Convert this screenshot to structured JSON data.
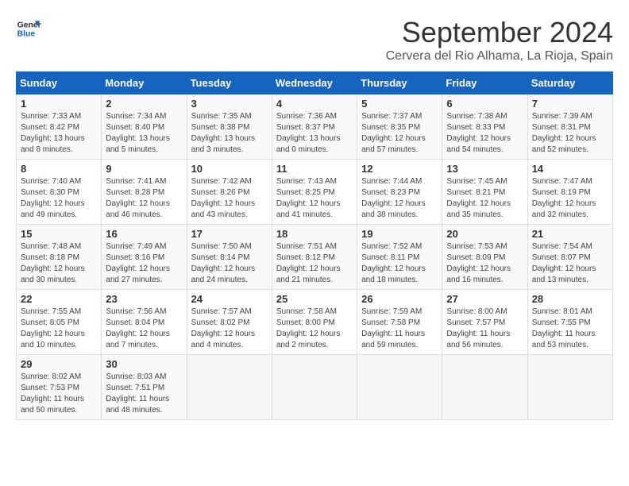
{
  "header": {
    "logo_line1": "General",
    "logo_line2": "Blue",
    "month_title": "September 2024",
    "location": "Cervera del Rio Alhama, La Rioja, Spain"
  },
  "days_of_week": [
    "Sunday",
    "Monday",
    "Tuesday",
    "Wednesday",
    "Thursday",
    "Friday",
    "Saturday"
  ],
  "weeks": [
    [
      {
        "day": "1",
        "sunrise": "7:33 AM",
        "sunset": "8:42 PM",
        "daylight": "13 hours and 8 minutes."
      },
      {
        "day": "2",
        "sunrise": "7:34 AM",
        "sunset": "8:40 PM",
        "daylight": "13 hours and 5 minutes."
      },
      {
        "day": "3",
        "sunrise": "7:35 AM",
        "sunset": "8:38 PM",
        "daylight": "13 hours and 3 minutes."
      },
      {
        "day": "4",
        "sunrise": "7:36 AM",
        "sunset": "8:37 PM",
        "daylight": "13 hours and 0 minutes."
      },
      {
        "day": "5",
        "sunrise": "7:37 AM",
        "sunset": "8:35 PM",
        "daylight": "12 hours and 57 minutes."
      },
      {
        "day": "6",
        "sunrise": "7:38 AM",
        "sunset": "8:33 PM",
        "daylight": "12 hours and 54 minutes."
      },
      {
        "day": "7",
        "sunrise": "7:39 AM",
        "sunset": "8:31 PM",
        "daylight": "12 hours and 52 minutes."
      }
    ],
    [
      {
        "day": "8",
        "sunrise": "7:40 AM",
        "sunset": "8:30 PM",
        "daylight": "12 hours and 49 minutes."
      },
      {
        "day": "9",
        "sunrise": "7:41 AM",
        "sunset": "8:28 PM",
        "daylight": "12 hours and 46 minutes."
      },
      {
        "day": "10",
        "sunrise": "7:42 AM",
        "sunset": "8:26 PM",
        "daylight": "12 hours and 43 minutes."
      },
      {
        "day": "11",
        "sunrise": "7:43 AM",
        "sunset": "8:25 PM",
        "daylight": "12 hours and 41 minutes."
      },
      {
        "day": "12",
        "sunrise": "7:44 AM",
        "sunset": "8:23 PM",
        "daylight": "12 hours and 38 minutes."
      },
      {
        "day": "13",
        "sunrise": "7:45 AM",
        "sunset": "8:21 PM",
        "daylight": "12 hours and 35 minutes."
      },
      {
        "day": "14",
        "sunrise": "7:47 AM",
        "sunset": "8:19 PM",
        "daylight": "12 hours and 32 minutes."
      }
    ],
    [
      {
        "day": "15",
        "sunrise": "7:48 AM",
        "sunset": "8:18 PM",
        "daylight": "12 hours and 30 minutes."
      },
      {
        "day": "16",
        "sunrise": "7:49 AM",
        "sunset": "8:16 PM",
        "daylight": "12 hours and 27 minutes."
      },
      {
        "day": "17",
        "sunrise": "7:50 AM",
        "sunset": "8:14 PM",
        "daylight": "12 hours and 24 minutes."
      },
      {
        "day": "18",
        "sunrise": "7:51 AM",
        "sunset": "8:12 PM",
        "daylight": "12 hours and 21 minutes."
      },
      {
        "day": "19",
        "sunrise": "7:52 AM",
        "sunset": "8:11 PM",
        "daylight": "12 hours and 18 minutes."
      },
      {
        "day": "20",
        "sunrise": "7:53 AM",
        "sunset": "8:09 PM",
        "daylight": "12 hours and 16 minutes."
      },
      {
        "day": "21",
        "sunrise": "7:54 AM",
        "sunset": "8:07 PM",
        "daylight": "12 hours and 13 minutes."
      }
    ],
    [
      {
        "day": "22",
        "sunrise": "7:55 AM",
        "sunset": "8:05 PM",
        "daylight": "12 hours and 10 minutes."
      },
      {
        "day": "23",
        "sunrise": "7:56 AM",
        "sunset": "8:04 PM",
        "daylight": "12 hours and 7 minutes."
      },
      {
        "day": "24",
        "sunrise": "7:57 AM",
        "sunset": "8:02 PM",
        "daylight": "12 hours and 4 minutes."
      },
      {
        "day": "25",
        "sunrise": "7:58 AM",
        "sunset": "8:00 PM",
        "daylight": "12 hours and 2 minutes."
      },
      {
        "day": "26",
        "sunrise": "7:59 AM",
        "sunset": "7:58 PM",
        "daylight": "11 hours and 59 minutes."
      },
      {
        "day": "27",
        "sunrise": "8:00 AM",
        "sunset": "7:57 PM",
        "daylight": "11 hours and 56 minutes."
      },
      {
        "day": "28",
        "sunrise": "8:01 AM",
        "sunset": "7:55 PM",
        "daylight": "11 hours and 53 minutes."
      }
    ],
    [
      {
        "day": "29",
        "sunrise": "8:02 AM",
        "sunset": "7:53 PM",
        "daylight": "11 hours and 50 minutes."
      },
      {
        "day": "30",
        "sunrise": "8:03 AM",
        "sunset": "7:51 PM",
        "daylight": "11 hours and 48 minutes."
      },
      null,
      null,
      null,
      null,
      null
    ]
  ]
}
